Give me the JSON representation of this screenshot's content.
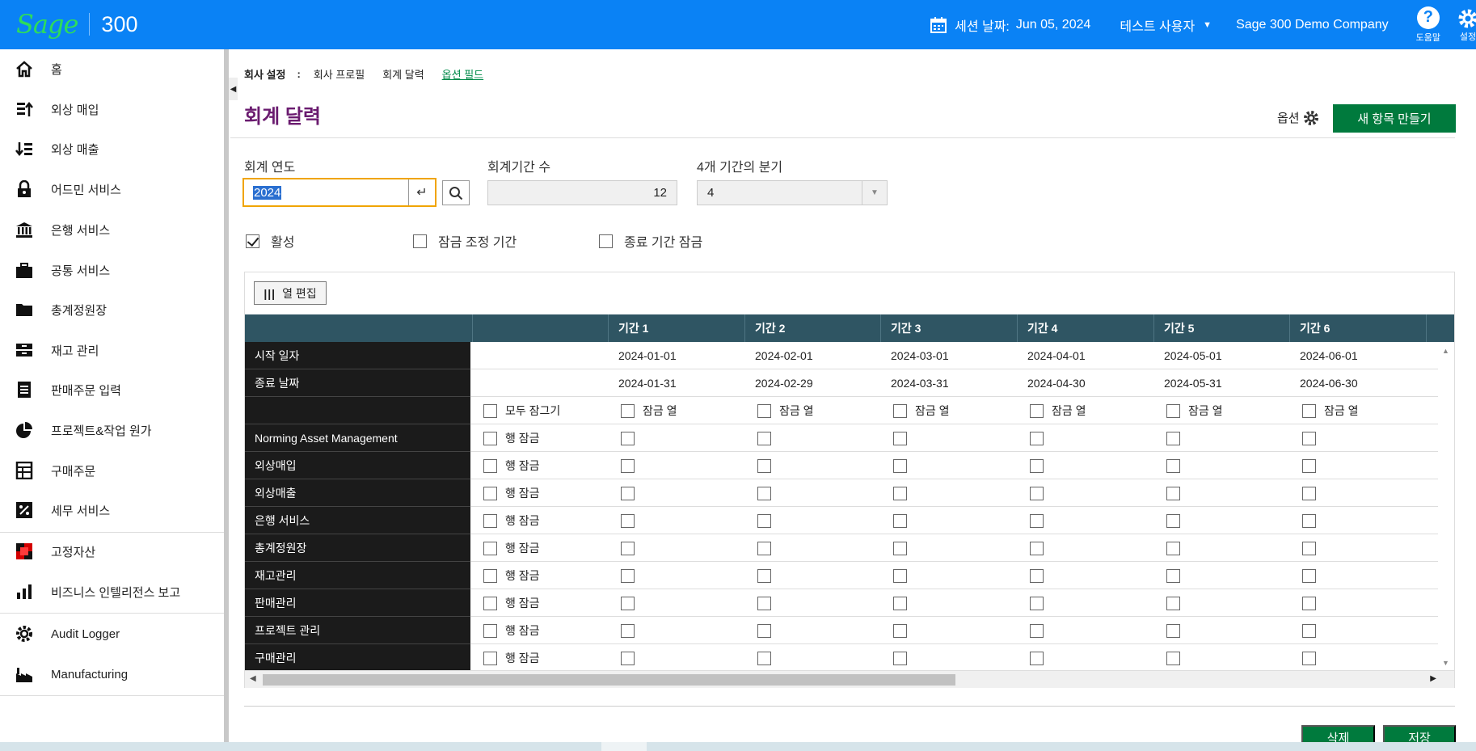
{
  "header": {
    "logo_brand": "Sage",
    "logo_product": "300",
    "session_label": "세션 날짜:",
    "session_date": "Jun 05, 2024",
    "user": "테스트 사용자",
    "company": "Sage 300 Demo Company",
    "help_label": "도움말",
    "settings_label": "설정",
    "brand_color": "#0a82f5"
  },
  "sidebar": {
    "items": [
      {
        "label": "홈",
        "icon": "home-icon"
      },
      {
        "label": "외상 매입",
        "icon": "payables-icon"
      },
      {
        "label": "외상 매출",
        "icon": "receivables-icon"
      },
      {
        "label": "어드민 서비스",
        "icon": "lock-icon"
      },
      {
        "label": "은행 서비스",
        "icon": "bank-icon"
      },
      {
        "label": "공통 서비스",
        "icon": "briefcase-icon"
      },
      {
        "label": "총계정원장",
        "icon": "folder-icon"
      },
      {
        "label": "재고 관리",
        "icon": "inventory-icon"
      },
      {
        "label": "판매주문 입력",
        "icon": "order-icon"
      },
      {
        "label": "프로젝트&작업 원가",
        "icon": "pie-icon"
      },
      {
        "label": "구매주문",
        "icon": "purchase-icon"
      },
      {
        "label": "세무 서비스",
        "icon": "percent-icon"
      },
      {
        "label": "고정자산",
        "icon": "fixed-assets-icon"
      },
      {
        "label": "비즈니스 인텔리전스 보고",
        "icon": "bar-chart-icon"
      },
      {
        "label": "Audit Logger",
        "icon": "gear-icon"
      },
      {
        "label": "Manufacturing",
        "icon": "factory-icon"
      }
    ]
  },
  "breadcrumb": {
    "root": "회사 설정",
    "sep": ":",
    "items": [
      "회사 프로필",
      "회계 달력"
    ],
    "link": "옵션 필드"
  },
  "page": {
    "title": "회계 달력",
    "options_label": "옵션",
    "new_button": "새 항목 만들기",
    "delete_button": "삭제",
    "save_button": "저장"
  },
  "form": {
    "fiscal_year_label": "회계 연도",
    "fiscal_year_value": "2024",
    "periods_label": "회계기간 수",
    "periods_value": "12",
    "quarter_label": "4개 기간의 분기",
    "quarter_value": "4",
    "active_label": "활성",
    "active_checked": true,
    "lock_adjust_label": "잠금 조정 기간",
    "lock_close_label": "종료 기간 잠금"
  },
  "grid": {
    "edit_columns_label": "열 편집",
    "periods": [
      "기간 1",
      "기간 2",
      "기간 3",
      "기간 4",
      "기간 5",
      "기간 6"
    ],
    "start_label": "시작 일자",
    "end_label": "종료 날짜",
    "start_dates": [
      "2024-01-01",
      "2024-02-01",
      "2024-03-01",
      "2024-04-01",
      "2024-05-01",
      "2024-06-01"
    ],
    "end_dates": [
      "2024-01-31",
      "2024-02-29",
      "2024-03-31",
      "2024-04-30",
      "2024-05-31",
      "2024-06-30"
    ],
    "lock_all_label": "모두 잠그기",
    "lock_col_label": "잠금 열",
    "lock_row_label": "행 잠금",
    "modules": [
      "Norming Asset Management",
      "외상매입",
      "외상매출",
      "은행 서비스",
      "총계정원장",
      "재고관리",
      "판매관리",
      "프로젝트 관리",
      "구매관리"
    ]
  }
}
